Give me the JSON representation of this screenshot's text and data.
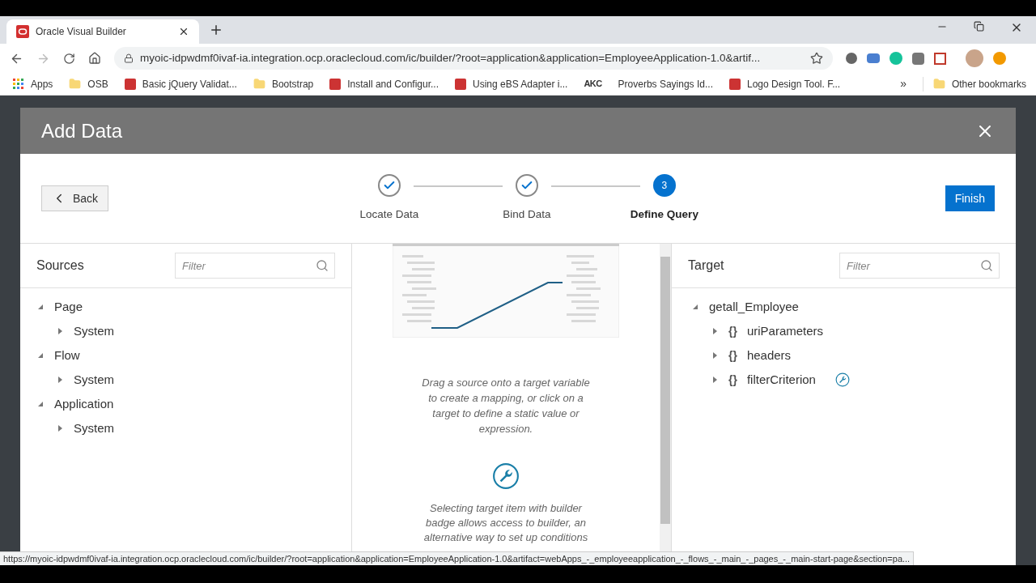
{
  "browser": {
    "tab_title": "Oracle Visual Builder",
    "url": "myoic-idpwdmf0ivaf-ia.integration.ocp.oraclecloud.com/ic/builder/?root=application&application=EmployeeApplication-1.0&artif...",
    "bookmarks": [
      {
        "label": "Apps",
        "kind": "apps"
      },
      {
        "label": "OSB",
        "kind": "folder"
      },
      {
        "label": "Basic jQuery Validat...",
        "kind": "site"
      },
      {
        "label": "Bootstrap",
        "kind": "folder"
      },
      {
        "label": "Install and Configur...",
        "kind": "site"
      },
      {
        "label": "Using eBS Adapter i...",
        "kind": "site"
      },
      {
        "label": "AKC",
        "kind": "text"
      },
      {
        "label": "Proverbs Sayings Id...",
        "kind": "plain"
      },
      {
        "label": "Logo Design Tool. F...",
        "kind": "site"
      }
    ],
    "more": "»",
    "other_bookmarks": "Other bookmarks"
  },
  "dialog": {
    "title": "Add Data",
    "back": "Back",
    "finish": "Finish",
    "steps": [
      {
        "label": "Locate Data",
        "completed": true,
        "current": false
      },
      {
        "label": "Bind Data",
        "completed": true,
        "current": false
      },
      {
        "label": "Define Query",
        "number": "3",
        "completed": false,
        "current": true
      }
    ],
    "sources": {
      "title": "Sources",
      "placeholder": "Filter",
      "tree": [
        {
          "label": "Page",
          "expanded": true,
          "children": [
            {
              "label": "System",
              "expanded": false
            }
          ]
        },
        {
          "label": "Flow",
          "expanded": true,
          "children": [
            {
              "label": "System",
              "expanded": false
            }
          ]
        },
        {
          "label": "Application",
          "expanded": true,
          "children": [
            {
              "label": "System",
              "expanded": false
            }
          ]
        }
      ]
    },
    "help": {
      "text1": "Drag a source onto a target variable to create a mapping, or click on a target to define a static value or expression.",
      "text2": "Selecting target item with builder badge allows access to builder, an alternative way to set up conditions"
    },
    "target": {
      "title": "Target",
      "placeholder": "Filter",
      "tree": [
        {
          "label": "getall_Employee",
          "expanded": true,
          "children": [
            {
              "label": "uriParameters",
              "braces": "{}",
              "expanded": false,
              "builder": false
            },
            {
              "label": "headers",
              "braces": "{}",
              "expanded": false,
              "builder": false
            },
            {
              "label": "filterCriterion",
              "braces": "{}",
              "expanded": false,
              "builder": true
            }
          ]
        }
      ]
    }
  },
  "status_url": "https://myoic-idpwdmf0ivaf-ia.integration.ocp.oraclecloud.com/ic/builder/?root=application&application=EmployeeApplication-1.0&artifact=webApps_-_employeeapplication_-_flows_-_main_-_pages_-_main-start-page&section=pa..."
}
